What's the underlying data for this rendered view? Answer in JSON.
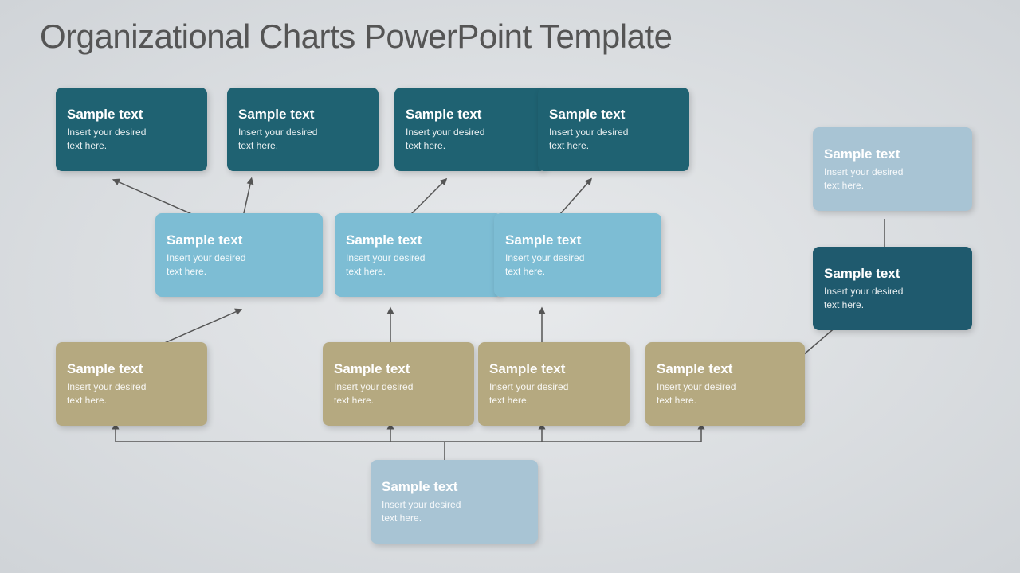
{
  "title": "Organizational Charts PowerPoint Template",
  "cards": {
    "row1": [
      {
        "id": "r1c1",
        "title": "Sample text",
        "sub": "Insert your desired\ntext here.",
        "color": "dark-teal"
      },
      {
        "id": "r1c2",
        "title": "Sample text",
        "sub": "Insert your desired\ntext here.",
        "color": "dark-teal"
      },
      {
        "id": "r1c3",
        "title": "Sample text",
        "sub": "Insert your desired\ntext here.",
        "color": "dark-teal"
      },
      {
        "id": "r1c4",
        "title": "Sample text",
        "sub": "Insert your desired\ntext here.",
        "color": "dark-teal"
      }
    ],
    "row2": [
      {
        "id": "r2c1",
        "title": "Sample text",
        "sub": "Insert your desired\ntext here.",
        "color": "light-blue"
      },
      {
        "id": "r2c2",
        "title": "Sample text",
        "sub": "Insert your desired\ntext here.",
        "color": "light-blue"
      },
      {
        "id": "r2c3",
        "title": "Sample text",
        "sub": "Insert your desired\ntext here.",
        "color": "light-blue"
      }
    ],
    "row3": [
      {
        "id": "r3c1",
        "title": "Sample text",
        "sub": "Insert your desired\ntext here.",
        "color": "tan"
      },
      {
        "id": "r3c2",
        "title": "Sample text",
        "sub": "Insert your desired\ntext here.",
        "color": "tan"
      },
      {
        "id": "r3c3",
        "title": "Sample text",
        "sub": "Insert your desired\ntext here.",
        "color": "tan"
      },
      {
        "id": "r3c4",
        "title": "Sample text",
        "sub": "Insert your desired\ntext here.",
        "color": "tan"
      }
    ],
    "right_top": {
      "id": "rt",
      "title": "Sample text",
      "sub": "Insert your desired\ntext here.",
      "color": "light-gray-blue"
    },
    "right_mid": {
      "id": "rm",
      "title": "Sample text",
      "sub": "Insert your desired\ntext here.",
      "color": "dark-teal-right"
    },
    "bottom_center": {
      "id": "bc",
      "title": "Sample text",
      "sub": "Insert your desired\ntext here.",
      "color": "bottom-center"
    }
  }
}
